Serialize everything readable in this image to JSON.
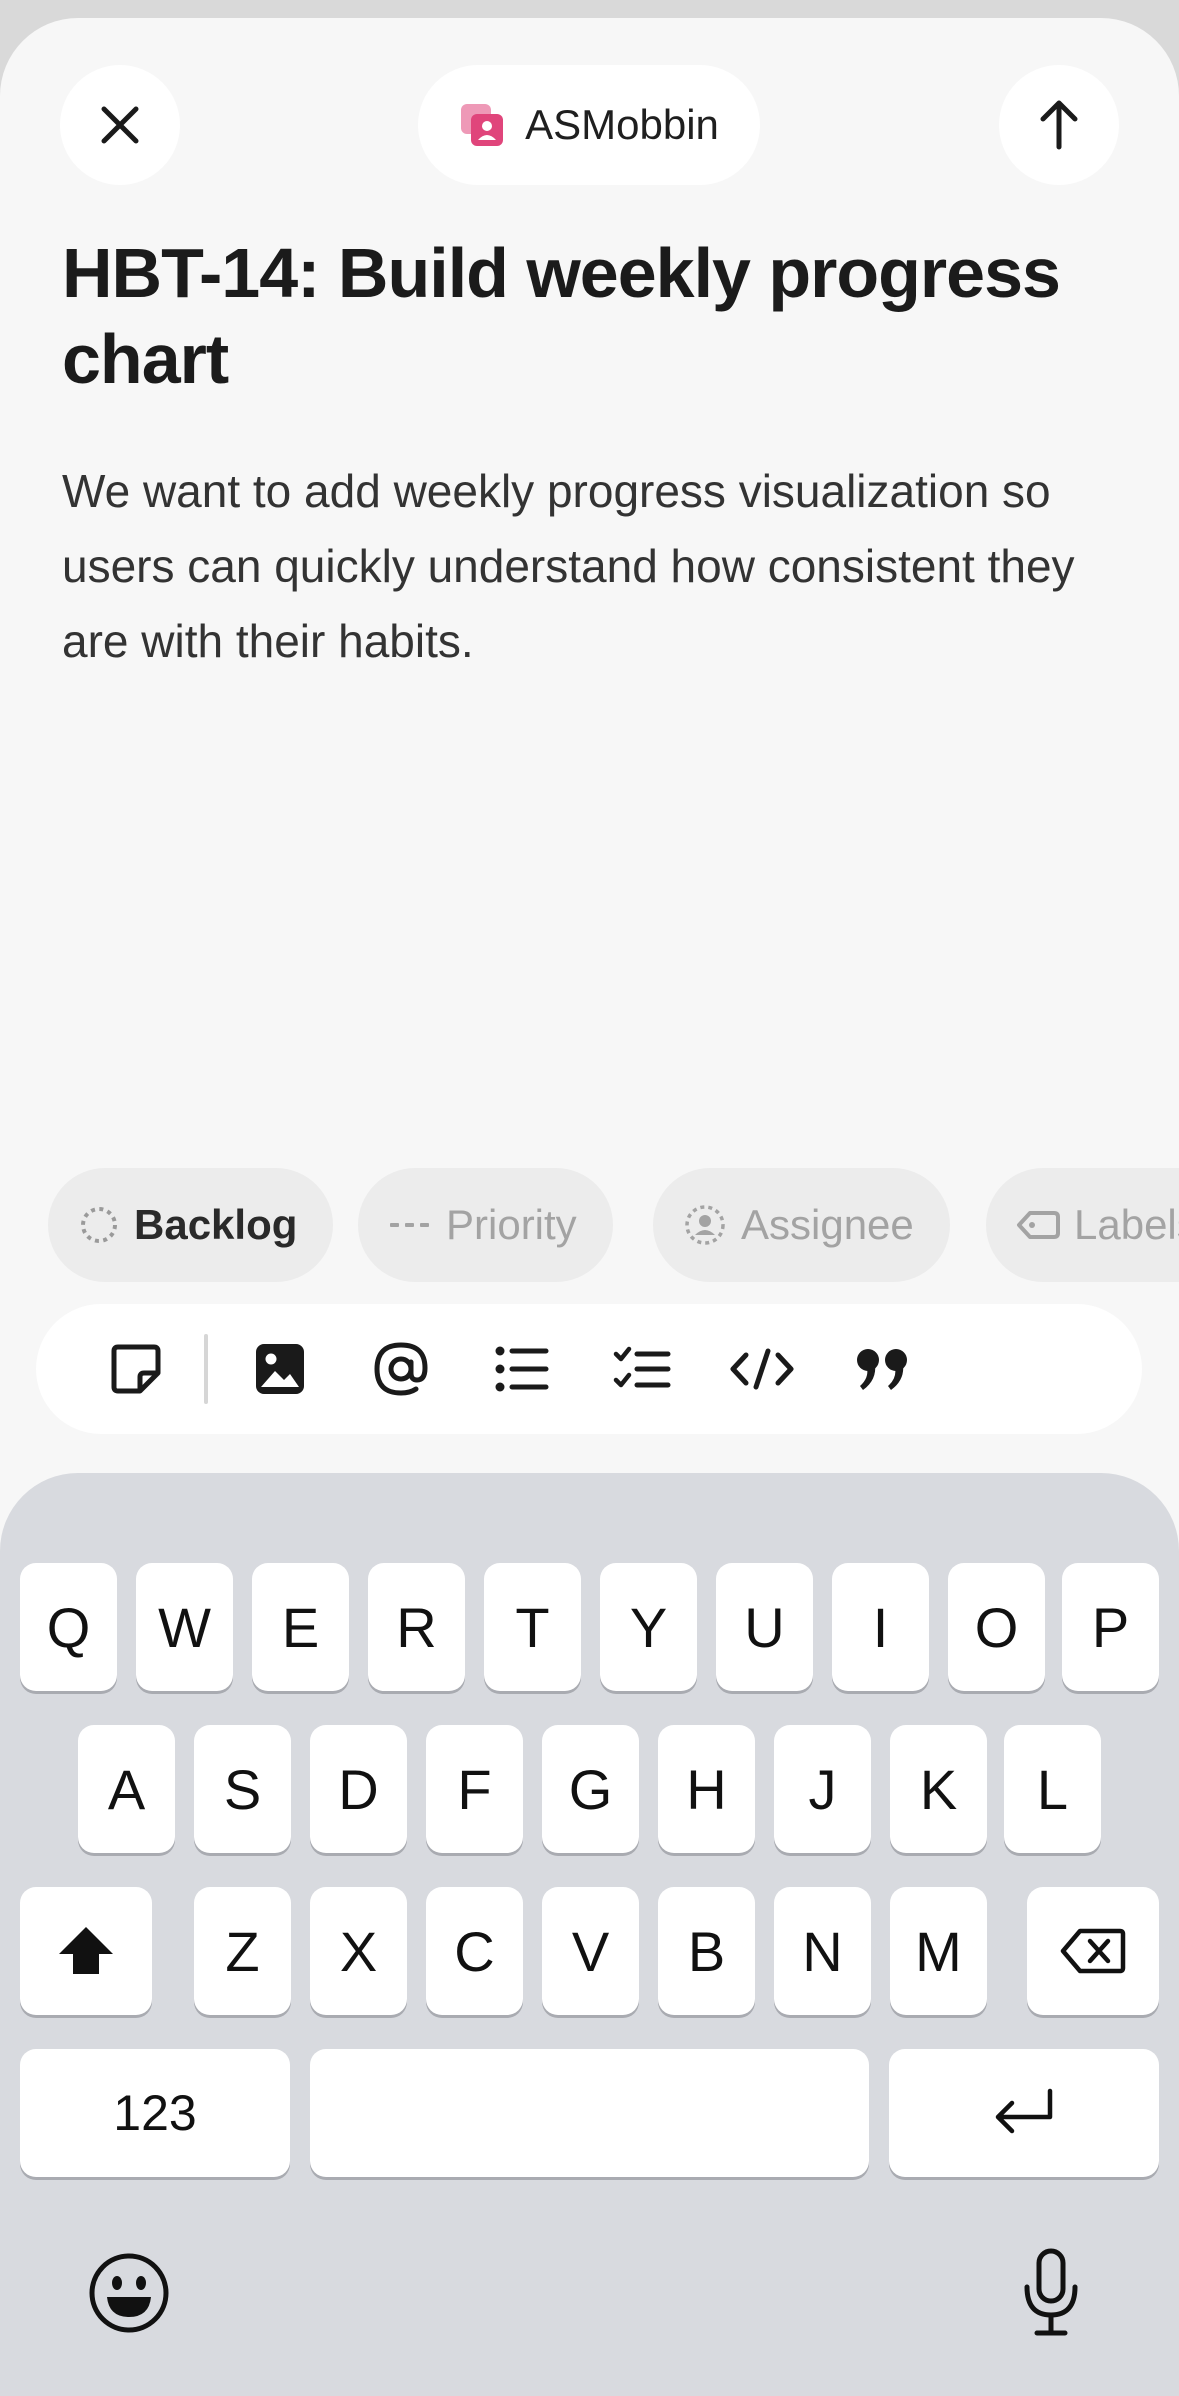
{
  "header": {
    "close_icon": "close-icon",
    "team_icon": "team-icon",
    "team_name": "ASMobbin",
    "team_icon_color": "#e0457b",
    "submit_icon": "arrow-up-icon"
  },
  "issue": {
    "title": "HBT-14: Build weekly progress chart",
    "description": "We want to add weekly progress visualization so users can quickly understand how consistent they are with their habits."
  },
  "chips": [
    {
      "label": "Backlog",
      "icon": "backlog-status-icon"
    },
    {
      "label": "Priority",
      "icon": "priority-icon"
    },
    {
      "label": "Assignee",
      "icon": "assignee-icon"
    },
    {
      "label": "Labels",
      "icon": "label-icon"
    }
  ],
  "toolbar": {
    "items": [
      "sticker-icon",
      "image-icon",
      "mention-icon",
      "bullet-list-icon",
      "checklist-icon",
      "code-icon",
      "quote-icon"
    ]
  },
  "keyboard": {
    "row1": [
      "Q",
      "W",
      "E",
      "R",
      "T",
      "Y",
      "U",
      "I",
      "O",
      "P"
    ],
    "row2": [
      "A",
      "S",
      "D",
      "F",
      "G",
      "H",
      "J",
      "K",
      "L"
    ],
    "row3": [
      "Z",
      "X",
      "C",
      "V",
      "B",
      "N",
      "M"
    ],
    "numbers_label": "123",
    "space_label": "",
    "shift_icon": "shift-icon",
    "delete_icon": "delete-icon",
    "return_icon": "return-icon",
    "emoji_icon": "emoji-icon",
    "mic_icon": "microphone-icon"
  }
}
